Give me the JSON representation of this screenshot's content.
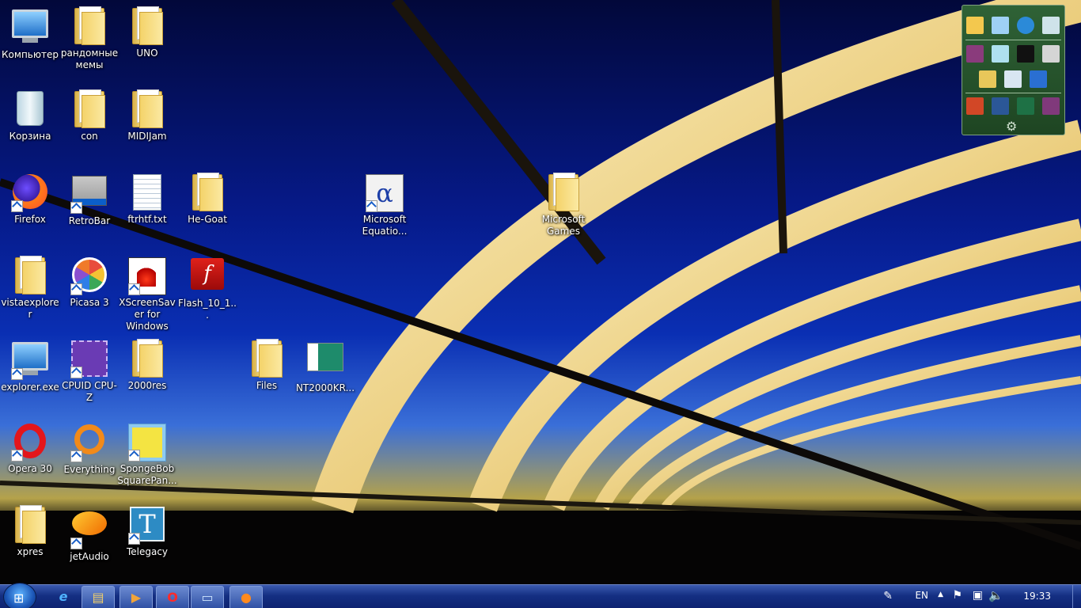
{
  "desktop_icons": [
    {
      "id": "komp",
      "label": "Компьютер"
    },
    {
      "id": "memes",
      "label": "рандомные мемы"
    },
    {
      "id": "uno",
      "label": "UNO"
    },
    {
      "id": "trash",
      "label": "Корзина"
    },
    {
      "id": "con",
      "label": "con"
    },
    {
      "id": "midijam",
      "label": "MIDIJam"
    },
    {
      "id": "firefox",
      "label": "Firefox"
    },
    {
      "id": "retrobar",
      "label": "RetroBar"
    },
    {
      "id": "ftrhtf",
      "label": "ftrhtf.txt"
    },
    {
      "id": "hegoat",
      "label": "He-Goat"
    },
    {
      "id": "msequation",
      "label": "Microsoft Equatio..."
    },
    {
      "id": "msgames",
      "label": "Microsoft Games"
    },
    {
      "id": "vistaexplorer",
      "label": "vistaexplorer"
    },
    {
      "id": "picasa",
      "label": "Picasa 3"
    },
    {
      "id": "xscreensaver",
      "label": "XScreenSaver for Windows"
    },
    {
      "id": "flash",
      "label": "Flash_10_1..."
    },
    {
      "id": "explorerexe",
      "label": "explorer.exe"
    },
    {
      "id": "cpuz",
      "label": "CPUID CPU-Z"
    },
    {
      "id": "res2000",
      "label": "2000res"
    },
    {
      "id": "files",
      "label": "Files"
    },
    {
      "id": "nt2000",
      "label": "NT2000KR..."
    },
    {
      "id": "opera",
      "label": "Opera 30"
    },
    {
      "id": "everything",
      "label": "Everything"
    },
    {
      "id": "spongebob",
      "label": "SpongeBob SquarePan..."
    },
    {
      "id": "xpres",
      "label": "xpres"
    },
    {
      "id": "jetaudio",
      "label": "jetAudio"
    },
    {
      "id": "telegacy",
      "label": "Telegacy"
    }
  ],
  "taskbar": {
    "start": "⊞",
    "buttons": [
      {
        "name": "internet-explorer",
        "glyph": "e"
      },
      {
        "name": "windows-explorer",
        "glyph": "▤"
      },
      {
        "name": "media-player",
        "glyph": "▶"
      },
      {
        "name": "opera",
        "glyph": "O"
      },
      {
        "name": "window",
        "glyph": "▭"
      },
      {
        "name": "firefox",
        "glyph": "●"
      }
    ],
    "tray": {
      "language": "EN",
      "time": "19:33"
    }
  },
  "colors": {
    "taskbar": "#142f82",
    "gadget": "#2f6236"
  }
}
